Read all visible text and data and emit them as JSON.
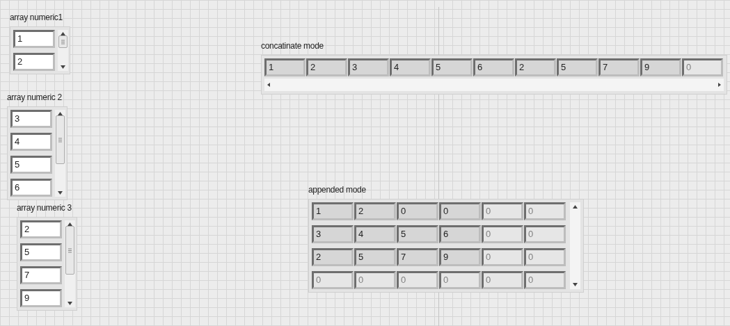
{
  "controls": [
    {
      "label": "array numeric1",
      "elements": [
        {
          "value": "1",
          "disabled": false
        },
        {
          "value": "2",
          "disabled": false
        }
      ]
    },
    {
      "label": "array numeric 2",
      "elements": [
        {
          "value": "3",
          "disabled": false
        },
        {
          "value": "4",
          "disabled": false
        },
        {
          "value": "5",
          "disabled": false
        },
        {
          "value": "6",
          "disabled": false
        }
      ]
    },
    {
      "label": "array numeric 3",
      "elements": [
        {
          "value": "2",
          "disabled": false
        },
        {
          "value": "5",
          "disabled": false
        },
        {
          "value": "7",
          "disabled": false
        },
        {
          "value": "9",
          "disabled": false
        }
      ]
    }
  ],
  "concatenate": {
    "label": "concatinate mode",
    "elements": [
      {
        "value": "1",
        "disabled": false
      },
      {
        "value": "2",
        "disabled": false
      },
      {
        "value": "3",
        "disabled": false
      },
      {
        "value": "4",
        "disabled": false
      },
      {
        "value": "5",
        "disabled": false
      },
      {
        "value": "6",
        "disabled": false
      },
      {
        "value": "2",
        "disabled": false
      },
      {
        "value": "5",
        "disabled": false
      },
      {
        "value": "7",
        "disabled": false
      },
      {
        "value": "9",
        "disabled": false
      },
      {
        "value": "0",
        "disabled": true
      }
    ]
  },
  "appended": {
    "label": "appended mode",
    "rows": [
      [
        {
          "value": "1",
          "disabled": false
        },
        {
          "value": "2",
          "disabled": false
        },
        {
          "value": "0",
          "disabled": false
        },
        {
          "value": "0",
          "disabled": false
        },
        {
          "value": "0",
          "disabled": true
        },
        {
          "value": "0",
          "disabled": true
        }
      ],
      [
        {
          "value": "3",
          "disabled": false
        },
        {
          "value": "4",
          "disabled": false
        },
        {
          "value": "5",
          "disabled": false
        },
        {
          "value": "6",
          "disabled": false
        },
        {
          "value": "0",
          "disabled": true
        },
        {
          "value": "0",
          "disabled": true
        }
      ],
      [
        {
          "value": "2",
          "disabled": false
        },
        {
          "value": "5",
          "disabled": false
        },
        {
          "value": "7",
          "disabled": false
        },
        {
          "value": "9",
          "disabled": false
        },
        {
          "value": "0",
          "disabled": true
        },
        {
          "value": "0",
          "disabled": true
        }
      ],
      [
        {
          "value": "0",
          "disabled": true
        },
        {
          "value": "0",
          "disabled": true
        },
        {
          "value": "0",
          "disabled": true
        },
        {
          "value": "0",
          "disabled": true
        },
        {
          "value": "0",
          "disabled": true
        },
        {
          "value": "0",
          "disabled": true
        }
      ]
    ]
  }
}
